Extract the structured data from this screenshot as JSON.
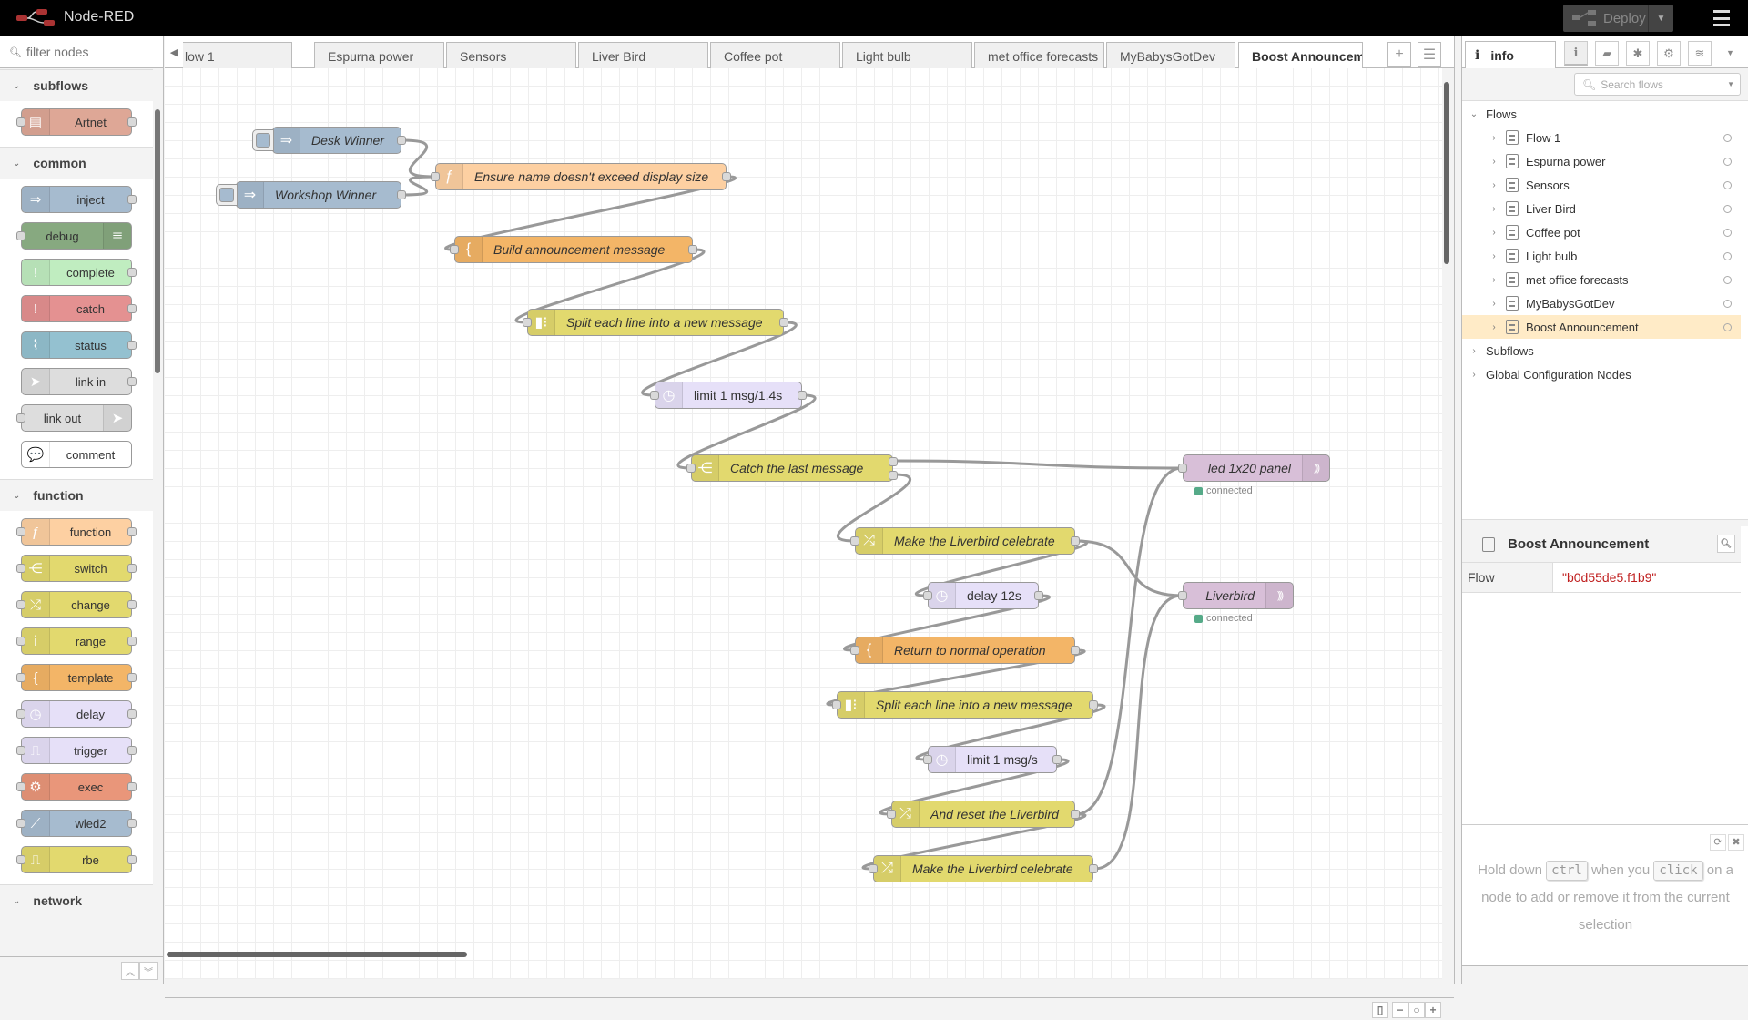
{
  "header": {
    "app_title": "Node-RED",
    "deploy_label": "Deploy"
  },
  "palette": {
    "filter_placeholder": "filter nodes",
    "categories": [
      {
        "name": "subflows",
        "nodes": [
          {
            "label": "Artnet",
            "color": "#dea796",
            "icon": "subflow-icon",
            "glyph": "▤",
            "in": true,
            "out": true
          }
        ]
      },
      {
        "name": "common",
        "nodes": [
          {
            "label": "inject",
            "color": "#a6bbcf",
            "icon": "arrow-in-icon",
            "glyph": "⇒",
            "in": false,
            "out": true
          },
          {
            "label": "debug",
            "color": "#87a980",
            "icon": "list-icon",
            "glyph": "≣",
            "in": true,
            "out": false,
            "right": true
          },
          {
            "label": "complete",
            "color": "#c0edc0",
            "icon": "alert-icon",
            "glyph": "!",
            "in": false,
            "out": true
          },
          {
            "label": "catch",
            "color": "#e49191",
            "icon": "alert-icon",
            "glyph": "!",
            "in": false,
            "out": true
          },
          {
            "label": "status",
            "color": "#94c1d0",
            "icon": "pulse-icon",
            "glyph": "⌇",
            "in": false,
            "out": true
          },
          {
            "label": "link in",
            "color": "#dddddd",
            "icon": "link-in-icon",
            "glyph": "➤",
            "in": false,
            "out": true
          },
          {
            "label": "link out",
            "color": "#dddddd",
            "icon": "link-out-icon",
            "glyph": "➤",
            "in": true,
            "out": false,
            "right": true
          },
          {
            "label": "comment",
            "color": "#ffffff",
            "icon": "comment-icon",
            "glyph": "💬",
            "in": false,
            "out": false
          }
        ]
      },
      {
        "name": "function",
        "nodes": [
          {
            "label": "function",
            "color": "#fdd0a2",
            "icon": "function-icon",
            "glyph": "ƒ",
            "in": true,
            "out": true
          },
          {
            "label": "switch",
            "color": "#e2d96e",
            "icon": "switch-icon",
            "glyph": "⋲",
            "in": true,
            "out": true
          },
          {
            "label": "change",
            "color": "#e2d96e",
            "icon": "shuffle-icon",
            "glyph": "⤮",
            "in": true,
            "out": true
          },
          {
            "label": "range",
            "color": "#e2d96e",
            "icon": "range-icon",
            "glyph": "ⅰ",
            "in": true,
            "out": true
          },
          {
            "label": "template",
            "color": "#f3b567",
            "icon": "brace-icon",
            "glyph": "{",
            "in": true,
            "out": true
          },
          {
            "label": "delay",
            "color": "#e6e0f8",
            "icon": "timer-icon",
            "glyph": "◷",
            "in": true,
            "out": true
          },
          {
            "label": "trigger",
            "color": "#e6e0f8",
            "icon": "trigger-icon",
            "glyph": "⎍",
            "in": true,
            "out": true
          },
          {
            "label": "exec",
            "color": "#e9967a",
            "icon": "cog-icon",
            "glyph": "⚙",
            "in": true,
            "out": true
          },
          {
            "label": "wled2",
            "color": "#a6bbcf",
            "icon": "wled-icon",
            "glyph": "⟋",
            "in": true,
            "out": true
          },
          {
            "label": "rbe",
            "color": "#e2d96e",
            "icon": "rbe-icon",
            "glyph": "⎍",
            "in": true,
            "out": true
          }
        ]
      },
      {
        "name": "network",
        "nodes": []
      }
    ]
  },
  "tabs": [
    {
      "label": "low 1"
    },
    {
      "label": "Espurna power"
    },
    {
      "label": "Sensors"
    },
    {
      "label": "Liver Bird"
    },
    {
      "label": "Coffee pot"
    },
    {
      "label": "Light bulb"
    },
    {
      "label": "met office forecasts"
    },
    {
      "label": "MyBabysGotDev"
    },
    {
      "label": "Boost Announcem",
      "active": true
    }
  ],
  "flow": {
    "nodes": [
      {
        "id": "n1",
        "label": "Desk Winner",
        "type": "inject",
        "color": "#a6bbcf",
        "glyph": "⇒",
        "inject": true
      },
      {
        "id": "n2",
        "label": "Workshop Winner",
        "type": "inject",
        "color": "#a6bbcf",
        "glyph": "⇒",
        "inject": true
      },
      {
        "id": "n3",
        "label": "Ensure name doesn't exceed display size",
        "type": "function",
        "color": "#fdd0a2",
        "glyph": "ƒ"
      },
      {
        "id": "n4",
        "label": "Build announcement message",
        "type": "template",
        "color": "#f3b567",
        "glyph": "{"
      },
      {
        "id": "n5",
        "label": "Split each line into a new message",
        "type": "split",
        "color": "#e2d96e",
        "glyph": "▮⁝"
      },
      {
        "id": "n6",
        "label": "limit 1 msg/1.4s",
        "type": "delay",
        "color": "#e6e0f8",
        "glyph": "◷",
        "plain": true
      },
      {
        "id": "n7",
        "label": "Catch the last message",
        "type": "switch",
        "color": "#e2d96e",
        "glyph": "⋲",
        "outputs": 2
      },
      {
        "id": "n8",
        "label": "led 1x20 panel",
        "type": "mqtt out",
        "color": "#d8bfd8",
        "glyph": ")))",
        "status": "connected"
      },
      {
        "id": "n9",
        "label": "Make the Liverbird celebrate",
        "type": "change",
        "color": "#e2d96e",
        "glyph": "⤮"
      },
      {
        "id": "n10",
        "label": "Liverbird",
        "type": "mqtt out",
        "color": "#d8bfd8",
        "glyph": ")))",
        "status": "connected"
      },
      {
        "id": "n11",
        "label": "delay 12s",
        "type": "delay",
        "color": "#e6e0f8",
        "glyph": "◷",
        "plain": true
      },
      {
        "id": "n12",
        "label": "Return to normal operation",
        "type": "template",
        "color": "#f3b567",
        "glyph": "{"
      },
      {
        "id": "n13",
        "label": "Split each line into a new message",
        "type": "split",
        "color": "#e2d96e",
        "glyph": "▮⁝"
      },
      {
        "id": "n14",
        "label": "limit 1 msg/s",
        "type": "delay",
        "color": "#e6e0f8",
        "glyph": "◷",
        "plain": true
      },
      {
        "id": "n15",
        "label": "And reset the Liverbird",
        "type": "change",
        "color": "#e2d96e",
        "glyph": "⤮"
      },
      {
        "id": "n16",
        "label": "Make the Liverbird celebrate",
        "type": "change",
        "color": "#e2d96e",
        "glyph": "⤮"
      }
    ],
    "wires": [
      [
        "n1",
        "n3"
      ],
      [
        "n2",
        "n3"
      ],
      [
        "n3",
        "n4"
      ],
      [
        "n4",
        "n5"
      ],
      [
        "n5",
        "n6"
      ],
      [
        "n6",
        "n7"
      ],
      [
        "n7:0",
        "n8"
      ],
      [
        "n7:1",
        "n9"
      ],
      [
        "n9",
        "n10"
      ],
      [
        "n9",
        "n11"
      ],
      [
        "n11",
        "n12"
      ],
      [
        "n12",
        "n13"
      ],
      [
        "n13",
        "n14"
      ],
      [
        "n14",
        "n15"
      ],
      [
        "n15",
        "n8"
      ],
      [
        "n15",
        "n16"
      ],
      [
        "n16",
        "n10"
      ]
    ]
  },
  "sidebar": {
    "tab_label": "info",
    "search_placeholder": "Search flows",
    "tree": {
      "flows_label": "Flows",
      "flows": [
        "Flow 1",
        "Espurna power",
        "Sensors",
        "Liver Bird",
        "Coffee pot",
        "Light bulb",
        "met office forecasts",
        "MyBabysGotDev",
        "Boost Announcement"
      ],
      "selected": "Boost Announcement",
      "subflows_label": "Subflows",
      "global_label": "Global Configuration Nodes"
    },
    "properties": {
      "title": "Boost Announcement",
      "key": "Flow",
      "value": "\"b0d55de5.f1b9\""
    },
    "tip": {
      "part1": "Hold down",
      "key1": "ctrl",
      "part2": "when you",
      "key2": "click",
      "part3": "on a node to add or remove it from the current selection"
    }
  }
}
